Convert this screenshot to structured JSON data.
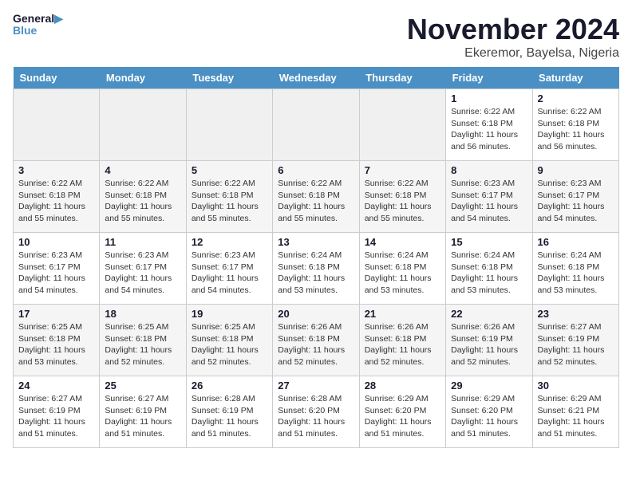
{
  "logo": {
    "line1": "General",
    "line2": "Blue"
  },
  "title": "November 2024",
  "location": "Ekeremor, Bayelsa, Nigeria",
  "weekdays": [
    "Sunday",
    "Monday",
    "Tuesday",
    "Wednesday",
    "Thursday",
    "Friday",
    "Saturday"
  ],
  "weeks": [
    [
      {
        "day": "",
        "info": ""
      },
      {
        "day": "",
        "info": ""
      },
      {
        "day": "",
        "info": ""
      },
      {
        "day": "",
        "info": ""
      },
      {
        "day": "",
        "info": ""
      },
      {
        "day": "1",
        "info": "Sunrise: 6:22 AM\nSunset: 6:18 PM\nDaylight: 11 hours and 56 minutes."
      },
      {
        "day": "2",
        "info": "Sunrise: 6:22 AM\nSunset: 6:18 PM\nDaylight: 11 hours and 56 minutes."
      }
    ],
    [
      {
        "day": "3",
        "info": "Sunrise: 6:22 AM\nSunset: 6:18 PM\nDaylight: 11 hours and 55 minutes."
      },
      {
        "day": "4",
        "info": "Sunrise: 6:22 AM\nSunset: 6:18 PM\nDaylight: 11 hours and 55 minutes."
      },
      {
        "day": "5",
        "info": "Sunrise: 6:22 AM\nSunset: 6:18 PM\nDaylight: 11 hours and 55 minutes."
      },
      {
        "day": "6",
        "info": "Sunrise: 6:22 AM\nSunset: 6:18 PM\nDaylight: 11 hours and 55 minutes."
      },
      {
        "day": "7",
        "info": "Sunrise: 6:22 AM\nSunset: 6:18 PM\nDaylight: 11 hours and 55 minutes."
      },
      {
        "day": "8",
        "info": "Sunrise: 6:23 AM\nSunset: 6:17 PM\nDaylight: 11 hours and 54 minutes."
      },
      {
        "day": "9",
        "info": "Sunrise: 6:23 AM\nSunset: 6:17 PM\nDaylight: 11 hours and 54 minutes."
      }
    ],
    [
      {
        "day": "10",
        "info": "Sunrise: 6:23 AM\nSunset: 6:17 PM\nDaylight: 11 hours and 54 minutes."
      },
      {
        "day": "11",
        "info": "Sunrise: 6:23 AM\nSunset: 6:17 PM\nDaylight: 11 hours and 54 minutes."
      },
      {
        "day": "12",
        "info": "Sunrise: 6:23 AM\nSunset: 6:17 PM\nDaylight: 11 hours and 54 minutes."
      },
      {
        "day": "13",
        "info": "Sunrise: 6:24 AM\nSunset: 6:18 PM\nDaylight: 11 hours and 53 minutes."
      },
      {
        "day": "14",
        "info": "Sunrise: 6:24 AM\nSunset: 6:18 PM\nDaylight: 11 hours and 53 minutes."
      },
      {
        "day": "15",
        "info": "Sunrise: 6:24 AM\nSunset: 6:18 PM\nDaylight: 11 hours and 53 minutes."
      },
      {
        "day": "16",
        "info": "Sunrise: 6:24 AM\nSunset: 6:18 PM\nDaylight: 11 hours and 53 minutes."
      }
    ],
    [
      {
        "day": "17",
        "info": "Sunrise: 6:25 AM\nSunset: 6:18 PM\nDaylight: 11 hours and 53 minutes."
      },
      {
        "day": "18",
        "info": "Sunrise: 6:25 AM\nSunset: 6:18 PM\nDaylight: 11 hours and 52 minutes."
      },
      {
        "day": "19",
        "info": "Sunrise: 6:25 AM\nSunset: 6:18 PM\nDaylight: 11 hours and 52 minutes."
      },
      {
        "day": "20",
        "info": "Sunrise: 6:26 AM\nSunset: 6:18 PM\nDaylight: 11 hours and 52 minutes."
      },
      {
        "day": "21",
        "info": "Sunrise: 6:26 AM\nSunset: 6:18 PM\nDaylight: 11 hours and 52 minutes."
      },
      {
        "day": "22",
        "info": "Sunrise: 6:26 AM\nSunset: 6:19 PM\nDaylight: 11 hours and 52 minutes."
      },
      {
        "day": "23",
        "info": "Sunrise: 6:27 AM\nSunset: 6:19 PM\nDaylight: 11 hours and 52 minutes."
      }
    ],
    [
      {
        "day": "24",
        "info": "Sunrise: 6:27 AM\nSunset: 6:19 PM\nDaylight: 11 hours and 51 minutes."
      },
      {
        "day": "25",
        "info": "Sunrise: 6:27 AM\nSunset: 6:19 PM\nDaylight: 11 hours and 51 minutes."
      },
      {
        "day": "26",
        "info": "Sunrise: 6:28 AM\nSunset: 6:19 PM\nDaylight: 11 hours and 51 minutes."
      },
      {
        "day": "27",
        "info": "Sunrise: 6:28 AM\nSunset: 6:20 PM\nDaylight: 11 hours and 51 minutes."
      },
      {
        "day": "28",
        "info": "Sunrise: 6:29 AM\nSunset: 6:20 PM\nDaylight: 11 hours and 51 minutes."
      },
      {
        "day": "29",
        "info": "Sunrise: 6:29 AM\nSunset: 6:20 PM\nDaylight: 11 hours and 51 minutes."
      },
      {
        "day": "30",
        "info": "Sunrise: 6:29 AM\nSunset: 6:21 PM\nDaylight: 11 hours and 51 minutes."
      }
    ]
  ]
}
